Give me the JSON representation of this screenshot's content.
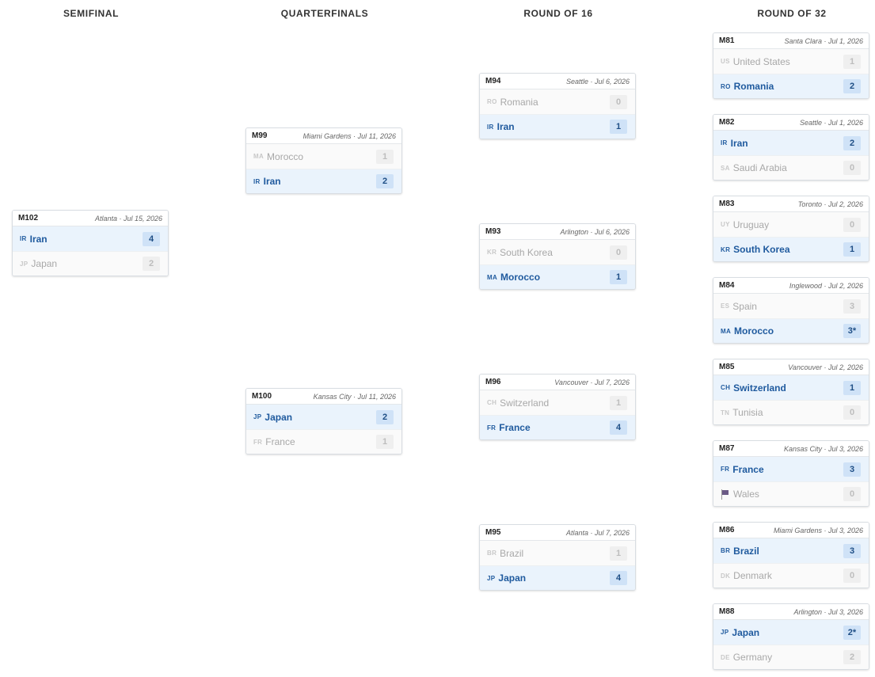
{
  "columns": {
    "semifinal": "SEMIFINAL",
    "quarterfinals": "QUARTERFINALS",
    "round16": "ROUND OF 16",
    "round32": "ROUND OF 32"
  },
  "matches": {
    "m102": {
      "id": "M102",
      "meta": "Atlanta · Jul 15, 2026",
      "t1": {
        "code": "IR",
        "name": "Iran",
        "score": "4"
      },
      "t2": {
        "code": "JP",
        "name": "Japan",
        "score": "2"
      }
    },
    "m99": {
      "id": "M99",
      "meta": "Miami Gardens · Jul 11, 2026",
      "t1": {
        "code": "MA",
        "name": "Morocco",
        "score": "1"
      },
      "t2": {
        "code": "IR",
        "name": "Iran",
        "score": "2"
      }
    },
    "m100": {
      "id": "M100",
      "meta": "Kansas City · Jul 11, 2026",
      "t1": {
        "code": "JP",
        "name": "Japan",
        "score": "2"
      },
      "t2": {
        "code": "FR",
        "name": "France",
        "score": "1"
      }
    },
    "m94": {
      "id": "M94",
      "meta": "Seattle · Jul 6, 2026",
      "t1": {
        "code": "RO",
        "name": "Romania",
        "score": "0"
      },
      "t2": {
        "code": "IR",
        "name": "Iran",
        "score": "1"
      }
    },
    "m93": {
      "id": "M93",
      "meta": "Arlington · Jul 6, 2026",
      "t1": {
        "code": "KR",
        "name": "South Korea",
        "score": "0"
      },
      "t2": {
        "code": "MA",
        "name": "Morocco",
        "score": "1"
      }
    },
    "m96": {
      "id": "M96",
      "meta": "Vancouver · Jul 7, 2026",
      "t1": {
        "code": "CH",
        "name": "Switzerland",
        "score": "1"
      },
      "t2": {
        "code": "FR",
        "name": "France",
        "score": "4"
      }
    },
    "m95": {
      "id": "M95",
      "meta": "Atlanta · Jul 7, 2026",
      "t1": {
        "code": "BR",
        "name": "Brazil",
        "score": "1"
      },
      "t2": {
        "code": "JP",
        "name": "Japan",
        "score": "4"
      }
    },
    "m81": {
      "id": "M81",
      "meta": "Santa Clara · Jul 1, 2026",
      "t1": {
        "code": "US",
        "name": "United States",
        "score": "1"
      },
      "t2": {
        "code": "RO",
        "name": "Romania",
        "score": "2"
      }
    },
    "m82": {
      "id": "M82",
      "meta": "Seattle · Jul 1, 2026",
      "t1": {
        "code": "IR",
        "name": "Iran",
        "score": "2"
      },
      "t2": {
        "code": "SA",
        "name": "Saudi Arabia",
        "score": "0"
      }
    },
    "m83": {
      "id": "M83",
      "meta": "Toronto · Jul 2, 2026",
      "t1": {
        "code": "UY",
        "name": "Uruguay",
        "score": "0"
      },
      "t2": {
        "code": "KR",
        "name": "South Korea",
        "score": "1"
      }
    },
    "m84": {
      "id": "M84",
      "meta": "Inglewood · Jul 2, 2026",
      "t1": {
        "code": "ES",
        "name": "Spain",
        "score": "3"
      },
      "t2": {
        "code": "MA",
        "name": "Morocco",
        "score": "3*"
      }
    },
    "m85": {
      "id": "M85",
      "meta": "Vancouver · Jul 2, 2026",
      "t1": {
        "code": "CH",
        "name": "Switzerland",
        "score": "1"
      },
      "t2": {
        "code": "TN",
        "name": "Tunisia",
        "score": "0"
      }
    },
    "m87": {
      "id": "M87",
      "meta": "Kansas City · Jul 3, 2026",
      "t1": {
        "code": "FR",
        "name": "France",
        "score": "3"
      },
      "t2": {
        "code": "",
        "name": "Wales",
        "score": "0",
        "icon": "flag-icon"
      }
    },
    "m86": {
      "id": "M86",
      "meta": "Miami Gardens · Jul 3, 2026",
      "t1": {
        "code": "BR",
        "name": "Brazil",
        "score": "3"
      },
      "t2": {
        "code": "DK",
        "name": "Denmark",
        "score": "0"
      }
    },
    "m88": {
      "id": "M88",
      "meta": "Arlington · Jul 3, 2026",
      "t1": {
        "code": "JP",
        "name": "Japan",
        "score": "2*"
      },
      "t2": {
        "code": "DE",
        "name": "Germany",
        "score": "2"
      }
    }
  },
  "colors": {
    "winner_bg": "#eaf3fc",
    "winner_text": "#1f5a9e",
    "loser_text": "#a8a8a8",
    "border": "#d8dde2"
  }
}
